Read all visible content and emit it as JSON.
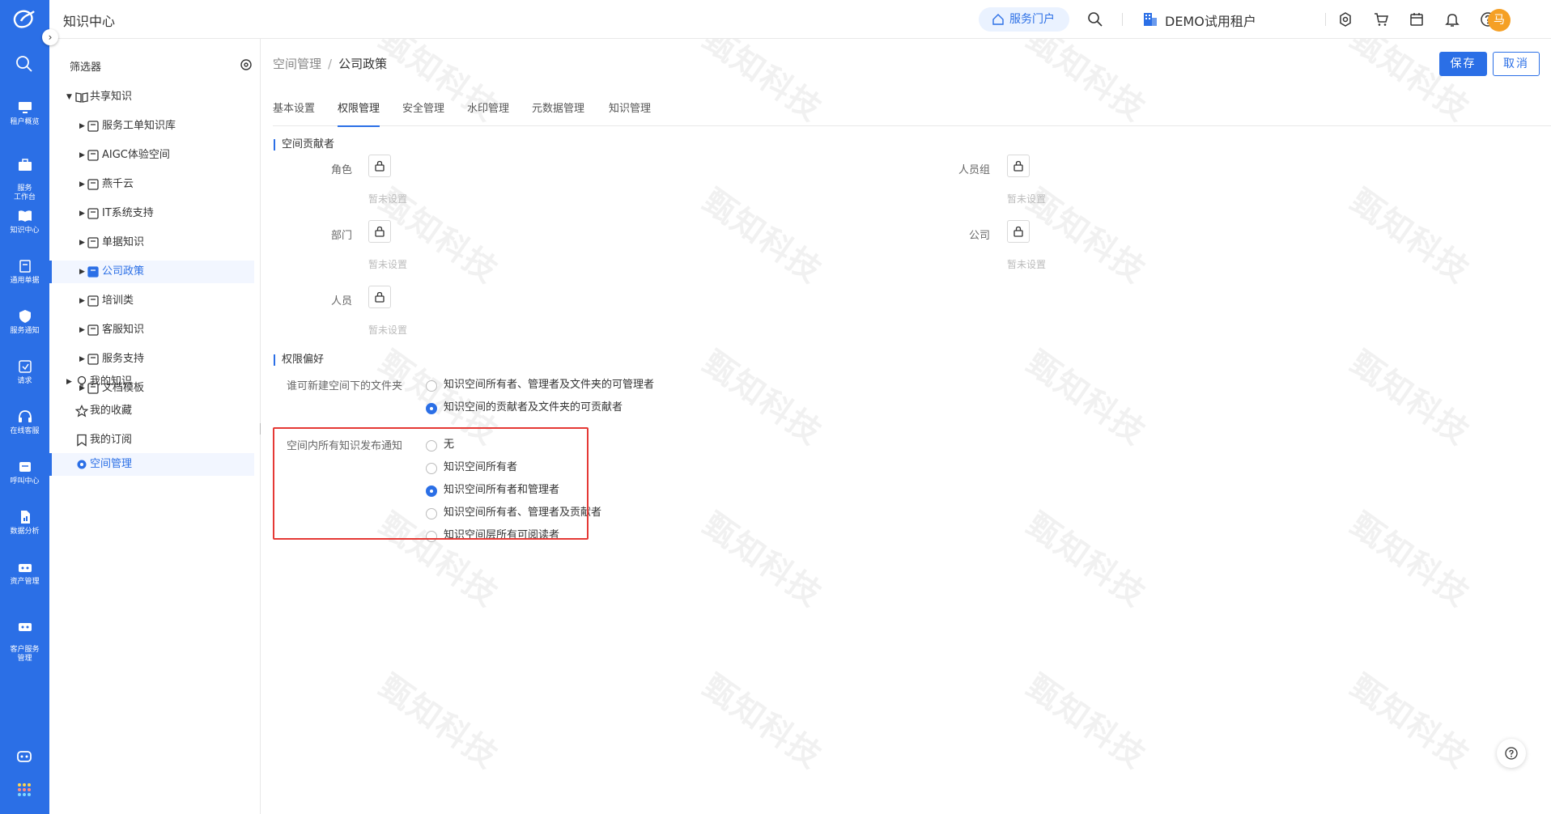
{
  "header": {
    "app_title": "知识中心",
    "portal_button": "服务门户",
    "tenant_name": "DEMO试用租户",
    "avatar_text": "马"
  },
  "rail": {
    "items": [
      {
        "label": "租户概览"
      },
      {
        "label": "服务\n工作台"
      },
      {
        "label": "知识中心"
      },
      {
        "label": "通用单据"
      },
      {
        "label": "服务通知"
      },
      {
        "label": "请求"
      },
      {
        "label": "在线客服"
      },
      {
        "label": "呼叫中心"
      },
      {
        "label": "数据分析"
      },
      {
        "label": "资产管理"
      },
      {
        "label": "客户服务\n管理"
      }
    ]
  },
  "filter": {
    "title": "筛选器",
    "shared_root": "共享知识",
    "spaces": [
      {
        "label": "服务工单知识库"
      },
      {
        "label": "AIGC体验空间"
      },
      {
        "label": "燕千云"
      },
      {
        "label": "IT系统支持"
      },
      {
        "label": "单据知识"
      },
      {
        "label": "公司政策"
      },
      {
        "label": "培训类"
      },
      {
        "label": "客服知识"
      },
      {
        "label": "服务支持"
      },
      {
        "label": "文档模板"
      }
    ],
    "my_knowledge": "我的知识",
    "my_favorites": "我的收藏",
    "my_subscriptions": "我的订阅",
    "space_management": "空间管理"
  },
  "breadcrumb": {
    "parent": "空间管理",
    "separator": "/",
    "current": "公司政策"
  },
  "actions": {
    "save": "保存",
    "cancel": "取消"
  },
  "tabs": [
    "基本设置",
    "权限管理",
    "安全管理",
    "水印管理",
    "元数据管理",
    "知识管理"
  ],
  "contributors": {
    "title": "空间贡献者",
    "role": "角色",
    "department": "部门",
    "person": "人员",
    "group": "人员组",
    "company": "公司",
    "unset": "暂未设置"
  },
  "preferences": {
    "title": "权限偏好",
    "folder_label": "谁可新建空间下的文件夹",
    "folder_options": [
      "知识空间所有者、管理者及文件夹的可管理者",
      "知识空间的贡献者及文件夹的可贡献者"
    ],
    "folder_selected": 1,
    "notify_label": "空间内所有知识发布通知",
    "notify_options": [
      "无",
      "知识空间所有者",
      "知识空间所有者和管理者",
      "知识空间所有者、管理者及贡献者",
      "知识空间层所有可阅读者"
    ],
    "notify_selected": 2
  },
  "watermark_text": "甄知科技",
  "colors": {
    "primary": "#2b6fe6",
    "highlight": "#e53935",
    "avatar": "#f5a025"
  }
}
